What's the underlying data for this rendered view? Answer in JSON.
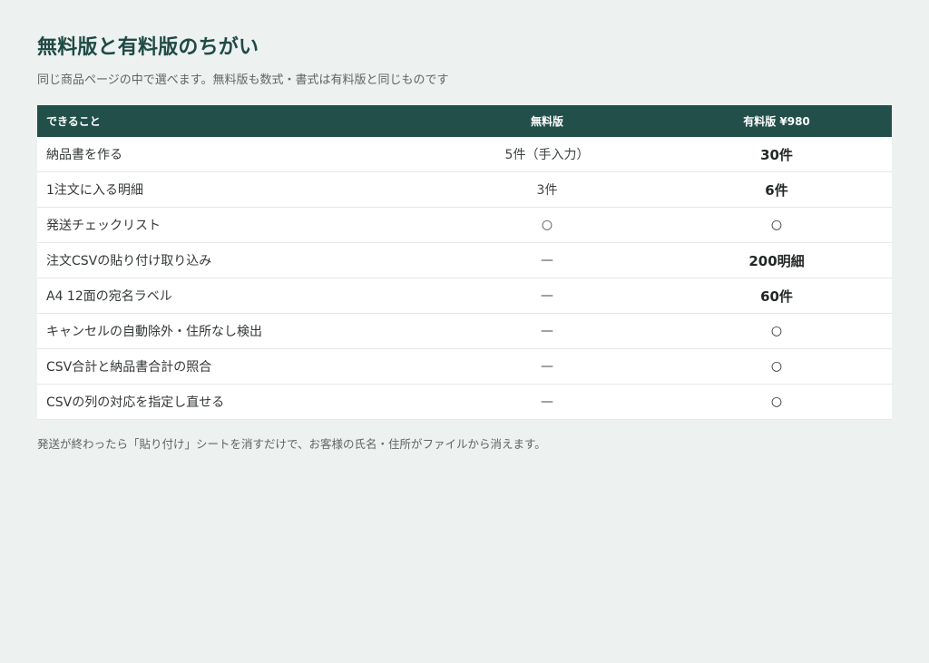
{
  "title": "無料版と有料版のちがい",
  "subtitle": "同じ商品ページの中で選べます。無料版も数式・書式は有料版と同じものです",
  "table": {
    "headers": {
      "feature": "できること",
      "free": "無料版",
      "paid": "有料版 ¥980"
    },
    "rows": [
      {
        "feature": "納品書を作る",
        "free": "5件（手入力）",
        "paid": "30件"
      },
      {
        "feature": "1注文に入る明細",
        "free": "3件",
        "paid": "6件"
      },
      {
        "feature": "発送チェックリスト",
        "free": "○",
        "paid": "○"
      },
      {
        "feature": "注文CSVの貼り付け取り込み",
        "free": "—",
        "paid": "200明細"
      },
      {
        "feature": "A4 12面の宛名ラベル",
        "free": "—",
        "paid": "60件"
      },
      {
        "feature": "キャンセルの自動除外・住所なし検出",
        "free": "—",
        "paid": "○"
      },
      {
        "feature": "CSV合計と納品書合計の照合",
        "free": "—",
        "paid": "○"
      },
      {
        "feature": "CSVの列の対応を指定し直せる",
        "free": "—",
        "paid": "○"
      }
    ]
  },
  "footnote": "発送が終わったら「貼り付け」シートを消すだけで、お客様の氏名・住所がファイルから消えます。"
}
